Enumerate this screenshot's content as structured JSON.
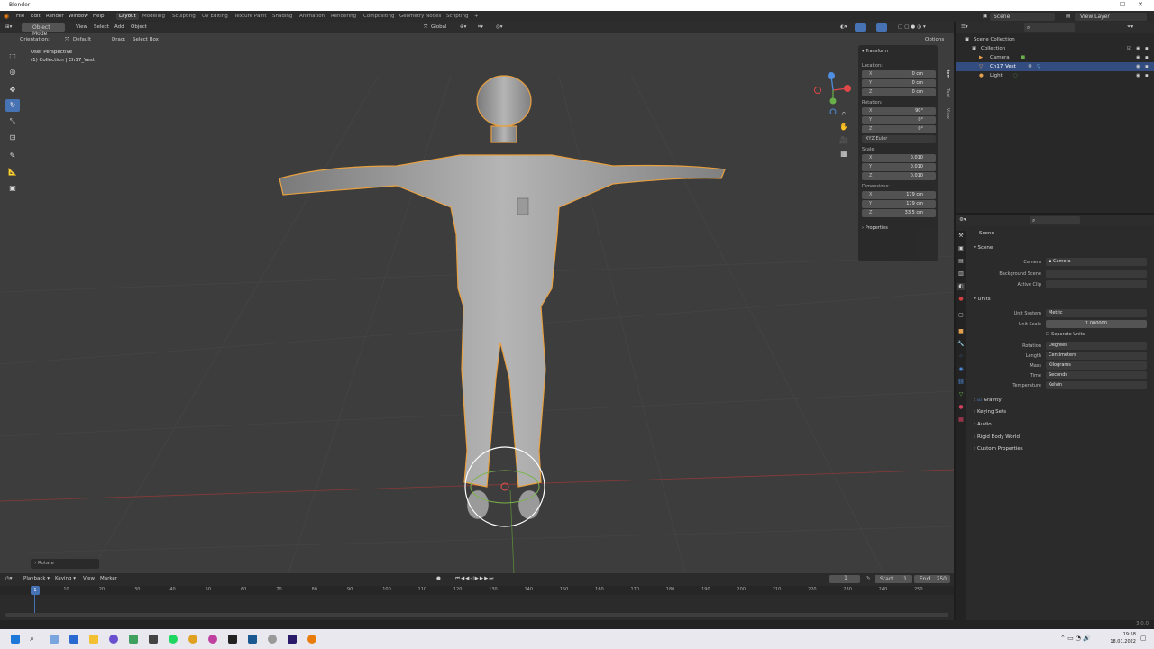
{
  "window": {
    "title": "Blender",
    "min": "—",
    "max": "☐",
    "close": "✕"
  },
  "menu": {
    "items": [
      "File",
      "Edit",
      "Render",
      "Window",
      "Help"
    ]
  },
  "workspaces": [
    "Layout",
    "Modeling",
    "Sculpting",
    "UV Editing",
    "Texture Paint",
    "Shading",
    "Animation",
    "Rendering",
    "Compositing",
    "Geometry Nodes",
    "Scripting",
    "+"
  ],
  "scene": {
    "label": "Scene",
    "viewlayer": "View Layer"
  },
  "viewport": {
    "mode": "Object Mode",
    "menus": [
      "View",
      "Select",
      "Add",
      "Object"
    ],
    "orientation_label": "Orientation:",
    "orientation_value": "Default",
    "drag_label": "Drag:",
    "drag_value": "Select Box",
    "transform_orientation": "Global",
    "options": "Options",
    "overlay_title": "User Perspective",
    "overlay_sub": "(1) Collection | Ch17_Vest",
    "operator_panel": "Rotate"
  },
  "npanel": {
    "header": "Transform",
    "location_label": "Location:",
    "location": [
      {
        "k": "X",
        "v": "0 cm"
      },
      {
        "k": "Y",
        "v": "0 cm"
      },
      {
        "k": "Z",
        "v": "0 cm"
      }
    ],
    "rotation_label": "Rotation:",
    "rotation": [
      {
        "k": "X",
        "v": "90°"
      },
      {
        "k": "Y",
        "v": "0°"
      },
      {
        "k": "Z",
        "v": "0°"
      }
    ],
    "rotation_mode": "XYZ Euler",
    "scale_label": "Scale:",
    "scale": [
      {
        "k": "X",
        "v": "0.010"
      },
      {
        "k": "Y",
        "v": "0.010"
      },
      {
        "k": "Z",
        "v": "0.010"
      }
    ],
    "dimensions_label": "Dimensions:",
    "dimensions": [
      {
        "k": "X",
        "v": "179 cm"
      },
      {
        "k": "Y",
        "v": "179 cm"
      },
      {
        "k": "Z",
        "v": "33.5 cm"
      }
    ],
    "properties": "Properties",
    "tabs": [
      "Item",
      "Tool",
      "View"
    ]
  },
  "outliner": {
    "rows": [
      {
        "label": "Scene Collection",
        "indent": 0,
        "selected": false
      },
      {
        "label": "Collection",
        "indent": 1,
        "selected": false
      },
      {
        "label": "Camera",
        "indent": 2,
        "selected": false
      },
      {
        "label": "Ch17_Vest",
        "indent": 2,
        "selected": true
      },
      {
        "label": "Light",
        "indent": 2,
        "selected": false
      }
    ]
  },
  "properties": {
    "breadcrumb": "Scene",
    "section_scene": "Scene",
    "camera_label": "Camera",
    "camera_value": "Camera",
    "bgscene_label": "Background Scene",
    "activeclip_label": "Active Clip",
    "section_units": "Units",
    "unit_system_label": "Unit System",
    "unit_system": "Metric",
    "unit_scale_label": "Unit Scale",
    "unit_scale": "1.000000",
    "separate_units": "Separate Units",
    "rotation_label": "Rotation",
    "rotation": "Degrees",
    "length_label": "Length",
    "length": "Centimeters",
    "mass_label": "Mass",
    "mass": "Kilograms",
    "time_label": "Time",
    "time": "Seconds",
    "temperature_label": "Temperature",
    "temperature": "Kelvin",
    "collapsed": [
      "Gravity",
      "Keying Sets",
      "Audio",
      "Rigid Body World",
      "Custom Properties"
    ]
  },
  "timeline": {
    "menus": [
      "Playback",
      "Keying",
      "View",
      "Marker"
    ],
    "current_frame": "1",
    "start_label": "Start",
    "start": "1",
    "end_label": "End",
    "end": "250",
    "ticks": [
      "1",
      "10",
      "20",
      "30",
      "40",
      "50",
      "60",
      "70",
      "80",
      "90",
      "100",
      "110",
      "120",
      "130",
      "140",
      "150",
      "160",
      "170",
      "180",
      "190",
      "200",
      "210",
      "220",
      "230",
      "240",
      "250"
    ]
  },
  "status": {
    "version": "3.0.0"
  },
  "taskbar": {
    "time": "19:58",
    "date": "18.01.2022"
  },
  "colors": {
    "accent": "#4772b3",
    "selection_outline": "#e8a040",
    "viewport_bg": "#3d3d3d"
  }
}
